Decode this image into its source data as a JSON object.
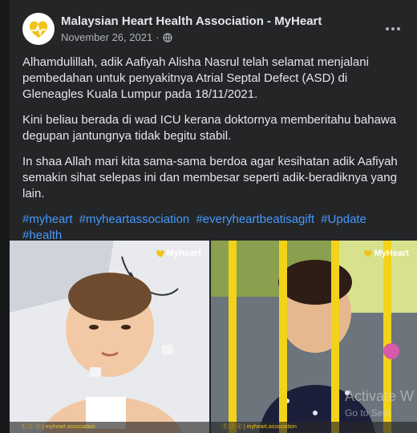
{
  "post": {
    "page_name": "Malaysian Heart Health Association - MyHeart",
    "date": "November 26, 2021",
    "separator": "·",
    "paragraphs": [
      "Alhamdulillah, adik Aafiyah Alisha Nasrul telah selamat menjalani pembedahan untuk penyakitnya Atrial Septal Defect (ASD) di Gleneagles Kuala Lumpur pada 18/11/2021.",
      "Kini beliau berada di wad ICU kerana doktornya memberitahu bahawa degupan jantungnya tidak begitu stabil.",
      "In shaa Allah mari kita sama-sama berdoa agar kesihatan adik Aafiyah semakin sihat selepas ini dan membesar seperti adik-beradiknya yang lain."
    ],
    "hashtags": [
      "#myheart",
      "#myheartassociation",
      "#everyheartbeatisagift",
      "#Update",
      "#health"
    ]
  },
  "photos": {
    "watermark": "MyHeart",
    "footer_text": "ⓕ ⓘ ⓨ | myheart.association"
  },
  "overlay": {
    "activate_line1": "Activate W",
    "activate_line2": "Go to Setti"
  },
  "icons": {
    "more": "more-options-icon",
    "privacy": "globe-icon"
  },
  "colors": {
    "card_bg": "#242526",
    "page_bg": "#18191a",
    "hashtag": "#4599ff",
    "brand_yellow": "#f0c419"
  }
}
